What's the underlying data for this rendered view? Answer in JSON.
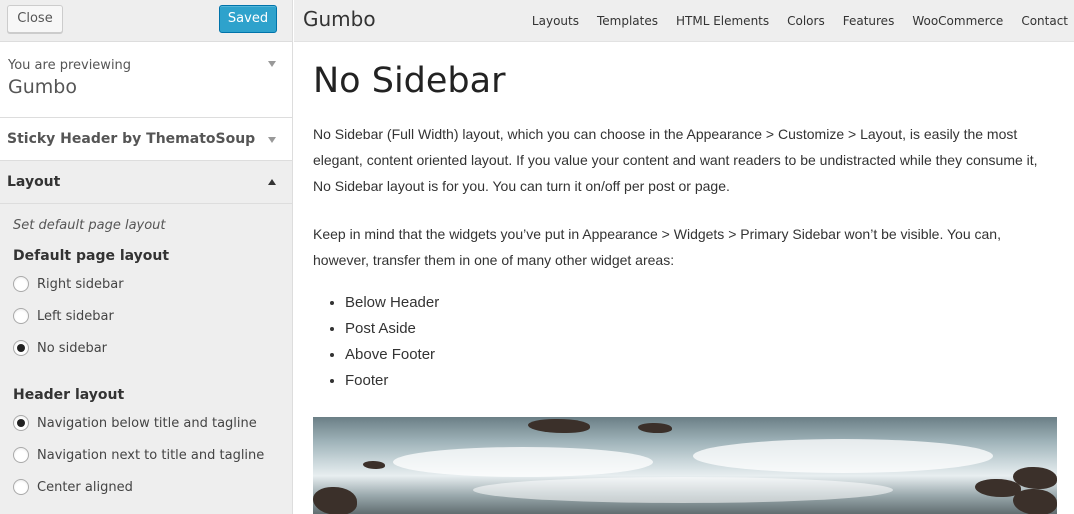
{
  "customizer": {
    "close_label": "Close",
    "saved_label": "Saved",
    "preview_small": "You are previewing",
    "theme_name": "Gumbo",
    "sections": [
      {
        "title": "Sticky Header by ThematoSoup"
      },
      {
        "title": "Layout"
      }
    ],
    "layout": {
      "description": "Set default page layout",
      "default_title": "Default page layout",
      "default_options": [
        {
          "label": "Right sidebar",
          "checked": false
        },
        {
          "label": "Left sidebar",
          "checked": false
        },
        {
          "label": "No sidebar",
          "checked": true
        }
      ],
      "header_title": "Header layout",
      "header_options": [
        {
          "label": "Navigation below title and tagline",
          "checked": true
        },
        {
          "label": "Navigation next to title and tagline",
          "checked": false
        },
        {
          "label": "Center aligned",
          "checked": false
        }
      ]
    }
  },
  "site": {
    "title": "Gumbo",
    "nav": [
      "Layouts",
      "Templates",
      "HTML Elements",
      "Colors",
      "Features",
      "WooCommerce",
      "Contact"
    ]
  },
  "page": {
    "title": "No Sidebar",
    "para1": "No Sidebar (Full Width) layout, which you can choose in the Appearance > Customize > Layout, is easily the most elegant, content oriented layout. If you value your content and want readers to be undistracted while they consume it, No Sidebar layout is for you. You can turn it on/off per post or page.",
    "para2": "Keep in mind that the widgets you’ve put in Appearance > Widgets > Primary Sidebar won’t be visible. You can, however, transfer them in one of many other widget areas:",
    "bullets": [
      "Below Header",
      "Post Aside",
      "Above Footer",
      "Footer"
    ]
  },
  "colors": {
    "accent": "#2ea2cc",
    "panel_bg": "#eeeeee"
  }
}
